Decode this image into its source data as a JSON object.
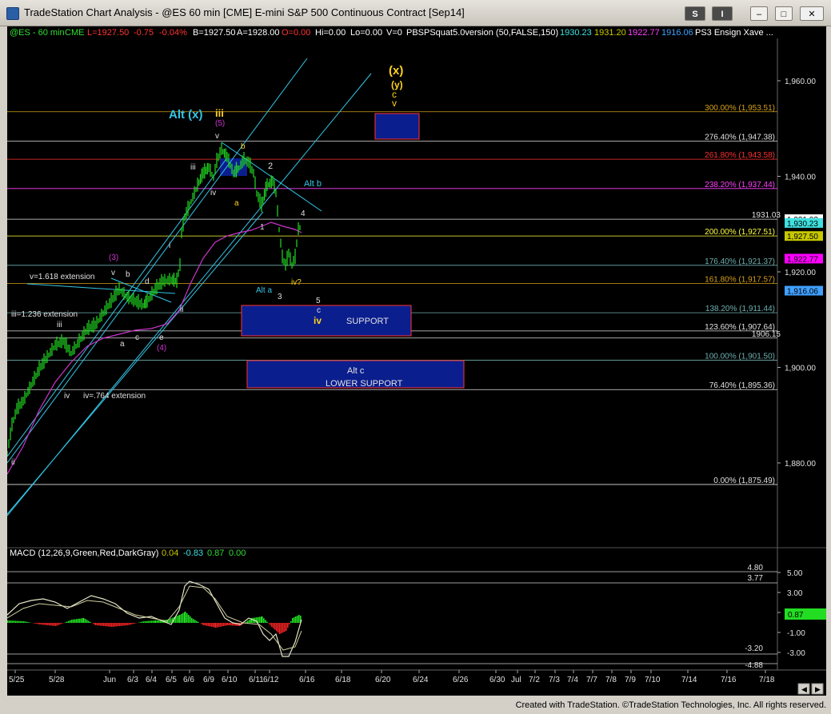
{
  "window": {
    "title": "TradeStation Chart Analysis - @ES 60 min [CME] E-mini S&P 500 Continuous Contract [Sep14]",
    "btn_s": "S",
    "btn_i": "I",
    "btn_min": "–",
    "btn_max": "□",
    "btn_close": "✕"
  },
  "header": {
    "symbol": "@ES - 60 min",
    "exchange": "CME",
    "last": "L=1927.50",
    "change": "-0.75",
    "change_pct": "-0.04%",
    "bid": "B=1927.50",
    "ask": "A=1928.00",
    "open": "O=0.00",
    "high": "Hi=0.00",
    "low": "Lo=0.00",
    "volume": "V=0",
    "study": "PBSPSquat5.0version (50,FALSE,150)",
    "v1": "1930.23",
    "v2": "1931.20",
    "v3": "1922.77",
    "v4": "1916.06",
    "study2": "PS3 Ensign Xave ..."
  },
  "price_axis": {
    "ticks": [
      "1,960.00",
      "1,940.00",
      "1,920.00",
      "1,900.00",
      "1,880.00"
    ],
    "flags": [
      {
        "label": "1,931.03",
        "color": "#ffffff"
      },
      {
        "label": "1,930.23",
        "color": "#40e0e0"
      },
      {
        "label": "1,927.50",
        "color": "#c8c800"
      },
      {
        "label": "1,922.77",
        "color": "#ff00ff"
      },
      {
        "label": "1,916.06",
        "color": "#40a0ff"
      }
    ]
  },
  "fib_levels": [
    {
      "label": "300.00% (1,953.51)",
      "color": "#d4a017"
    },
    {
      "label": "276.40% (1,947.38)",
      "color": "#e0e0e0"
    },
    {
      "label": "261.80% (1,943.58)",
      "color": "#ff3030"
    },
    {
      "label": "238.20% (1,937.44)",
      "color": "#ff40ff"
    },
    {
      "label": "200.00% (1,927.51)",
      "color": "#ffff40"
    },
    {
      "label": "176.40% (1,921.37)",
      "color": "#6fb0b0"
    },
    {
      "label": "161.80% (1,917.57)",
      "color": "#d4a017"
    },
    {
      "label": "138.20% (1,911.44)",
      "color": "#6fb0b0"
    },
    {
      "label": "123.60% (1,907.64)",
      "color": "#e0e0e0"
    },
    {
      "label": "100.00% (1,901.50)",
      "color": "#6fb0b0"
    },
    {
      "label": "76.40% (1,895.36)",
      "color": "#e0e0e0"
    },
    {
      "label": "0.00% (1,875.49)",
      "color": "#e0e0e0"
    }
  ],
  "line_labels": {
    "l_1931": "1931.03",
    "l_1906": "1906.15"
  },
  "annotations": {
    "x_yellow": "(x)",
    "y_yellow": "(y)",
    "c_yellow": "c",
    "v_yellow": "v",
    "alt_x": "Alt (x)",
    "iii_top": "iii",
    "five_magenta": "(5)",
    "v_small": "v",
    "b_small": "b",
    "two": "2",
    "alt_b": "Alt b",
    "iii_small": "iii",
    "iv_small": "iv",
    "a_small": "a",
    "four": "4",
    "one": "1",
    "i_small": "i",
    "three_magenta": "(3)",
    "v_ext": "v=1.618 extension",
    "alt_a": "Alt a",
    "three": "3",
    "iv_q": "iv?",
    "five": "5",
    "c_small": "c",
    "iv_yellow": "iv",
    "support": "SUPPORT",
    "ii_small": "ii",
    "iii_ext": "iii=1.236 extension",
    "iii_left": "iii",
    "a_left": "a",
    "c_left": "c",
    "e_left": "e",
    "four_magenta": "(4)",
    "d_small": "d",
    "b_left": "b",
    "alt_c": "Alt c",
    "lower_support": "LOWER SUPPORT",
    "iv_left": "iv",
    "iv_ext": "iv=.764 extension",
    "ii_bottom": "ii"
  },
  "macd": {
    "label": "MACD (12,26,9,Green,Red,DarkGray)",
    "v1": "0.04",
    "v2": "-0.83",
    "v3": "0.87",
    "v4": "0.00",
    "ticks": [
      "5.00",
      "3.00",
      "1.00",
      "-1.00",
      "-3.00"
    ],
    "level_480": "4.80",
    "level_377": "3.77",
    "level_m320": "-3.20",
    "level_m488": "-4.88",
    "flag": "0.87"
  },
  "date_axis": [
    "5/25",
    "5/28",
    "Jun",
    "6/3",
    "6/4",
    "6/5",
    "6/6",
    "6/9",
    "6/10",
    "6/11",
    "6/12",
    "6/16",
    "6/18",
    "6/20",
    "6/24",
    "6/26",
    "6/30",
    "Jul",
    "7/2",
    "7/3",
    "7/4",
    "7/7",
    "7/8",
    "7/9",
    "7/10",
    "7/14",
    "7/16",
    "7/18"
  ],
  "status_bar": {
    "text": "Created with TradeStation. ©TradeStation Technologies, Inc. All rights reserved."
  },
  "colors": {
    "background": "#000000",
    "price_bars": "#22dd22",
    "channel": "#33c6e6",
    "moving_avg": "#cc33cc"
  }
}
